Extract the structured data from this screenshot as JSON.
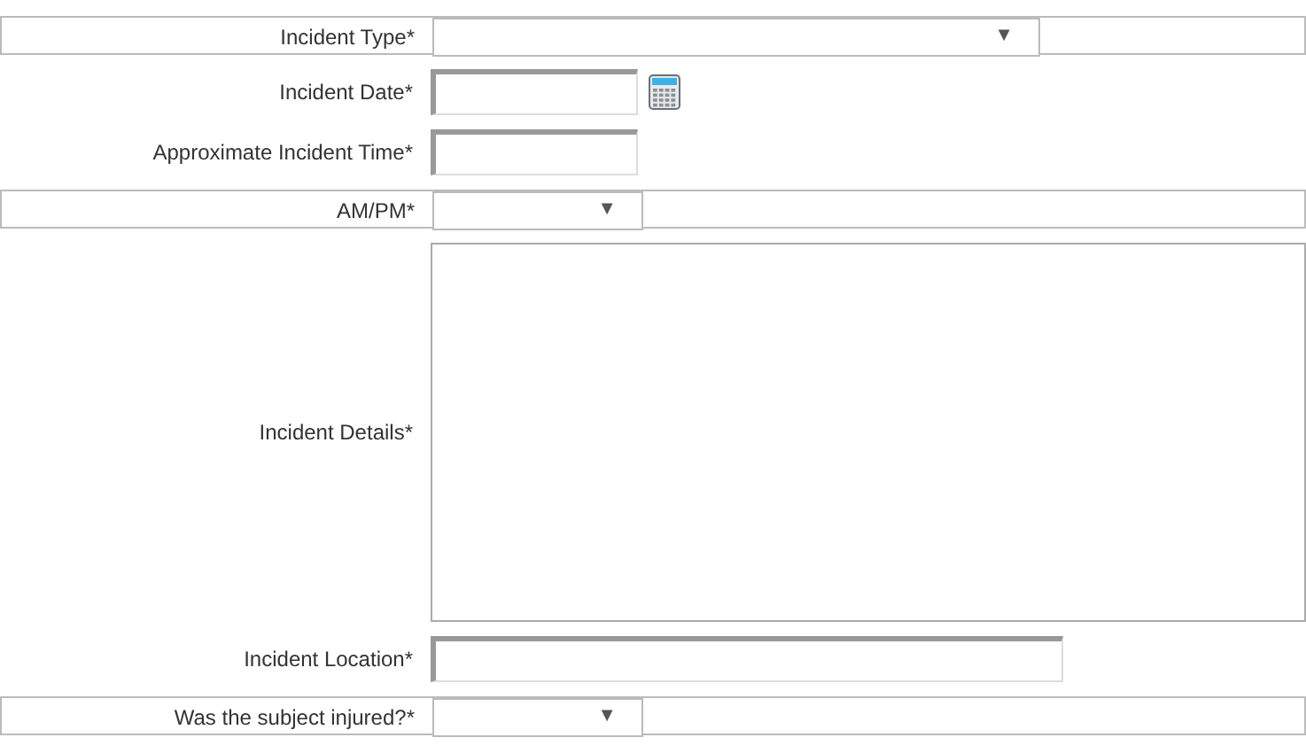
{
  "fields": [
    {
      "label": "Incident Type*",
      "kind": "select",
      "caret": "▼"
    },
    {
      "label": "Incident Date*",
      "kind": "date"
    },
    {
      "label": "Approximate Incident Time*",
      "kind": "text"
    },
    {
      "label": "AM/PM*",
      "kind": "select",
      "caret": "▼"
    },
    {
      "label": "Incident Details*",
      "kind": "textarea"
    },
    {
      "label": "Incident Location*",
      "kind": "text"
    },
    {
      "label": "Was the subject injured?*",
      "kind": "select",
      "caret": "▼"
    }
  ]
}
